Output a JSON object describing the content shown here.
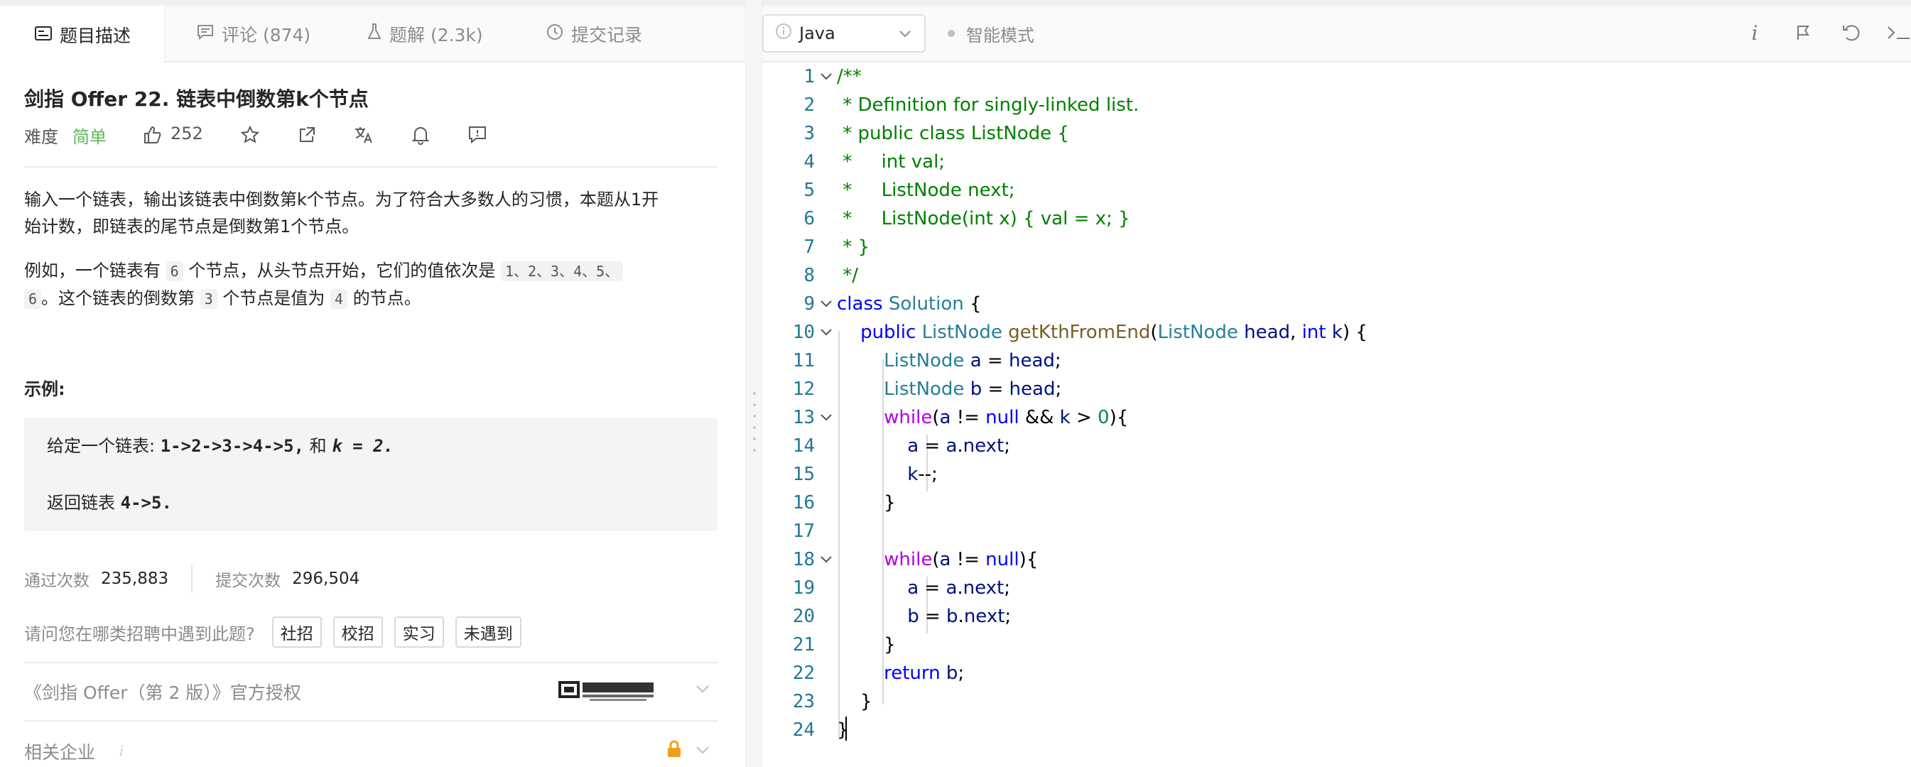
{
  "tabs": [
    {
      "label": "题目描述",
      "icon": "description-icon",
      "active": true
    },
    {
      "label": "评论 (874)",
      "icon": "comment-icon",
      "active": false
    },
    {
      "label": "题解 (2.3k)",
      "icon": "flask-icon",
      "active": false
    },
    {
      "label": "提交记录",
      "icon": "clock-icon",
      "active": false
    }
  ],
  "problem": {
    "title": "剑指 Offer 22. 链表中倒数第k个节点",
    "difficulty_label": "难度",
    "difficulty_value": "简单",
    "likes": "252",
    "description_1": "输入一个链表，输出该链表中倒数第k个节点。为了符合大多数人的习惯，本题从1开",
    "description_1b": "始计数，即链表的尾节点是倒数第1个节点。",
    "description_2_prefix": "例如，一个链表有",
    "description_2_n": "6",
    "description_2_mid": "个节点，从头节点开始，它们的值依次是",
    "description_2_vals": "1、2、3、4、5、",
    "description_2_vals2": "6",
    "description_2_mid2": "。这个链表的倒数第",
    "description_2_k": "3",
    "description_2_mid3": "个节点是值为",
    "description_2_v": "4",
    "description_2_end": "的节点。",
    "example_heading": "示例:",
    "example_line1_prefix": "给定一个链表:",
    "example_line1_list": "1->2->3->4->5,",
    "example_line1_and": "和",
    "example_line1_k": "k = 2.",
    "example_line2_prefix": "返回链表",
    "example_line2_value": "4->5."
  },
  "stats": {
    "accepted_label": "通过次数",
    "accepted_value": "235,883",
    "submitted_label": "提交次数",
    "submitted_value": "296,504"
  },
  "recruit": {
    "question": "请问您在哪类招聘中遇到此题?",
    "options": [
      "社招",
      "校招",
      "实习",
      "未遇到"
    ]
  },
  "offer_row": "《剑指 Offer（第 2 版）》官方授权",
  "publisher_logo_text": "電子工業出版社",
  "companies_label": "相关企业",
  "editor": {
    "language": "Java",
    "mode_label": "智能模式",
    "toolbar_icons": [
      "info-icon",
      "run-icon",
      "reset-icon",
      "console-icon"
    ],
    "code_lines": [
      "/**",
      " * Definition for singly-linked list.",
      " * public class ListNode {",
      " *     int val;",
      " *     ListNode next;",
      " *     ListNode(int x) { val = x; }",
      " * }",
      " */",
      "class Solution {",
      "    public ListNode getKthFromEnd(ListNode head, int k) {",
      "        ListNode a = head;",
      "        ListNode b = head;",
      "        while(a != null && k > 0){",
      "            a = a.next;",
      "            k--;",
      "        }",
      "",
      "        while(a != null){",
      "            a = a.next;",
      "            b = b.next;",
      "        }",
      "        return b;",
      "    }",
      "}"
    ],
    "line_numbers": [
      "1",
      "2",
      "3",
      "4",
      "5",
      "6",
      "7",
      "8",
      "9",
      "10",
      "11",
      "12",
      "13",
      "14",
      "15",
      "16",
      "17",
      "18",
      "19",
      "20",
      "21",
      "22",
      "23",
      "24"
    ]
  }
}
